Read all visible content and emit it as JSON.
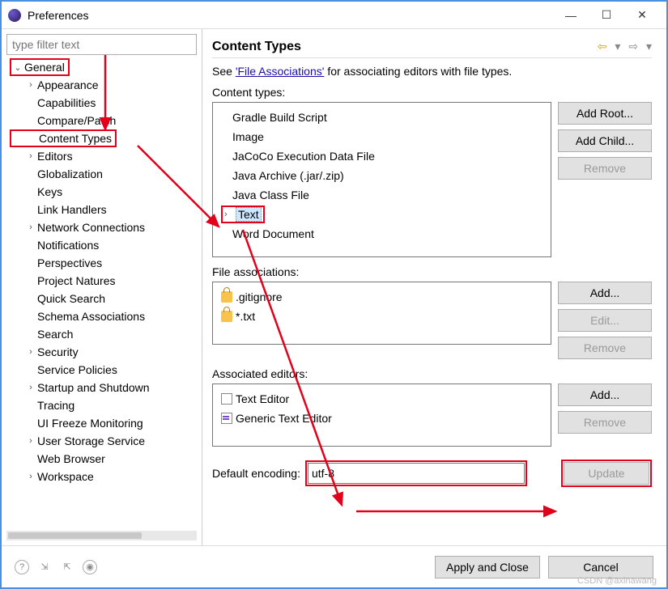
{
  "window": {
    "title": "Preferences"
  },
  "filter": {
    "placeholder": "type filter text"
  },
  "tree": {
    "root": "General",
    "items": [
      {
        "label": "Appearance",
        "chev": true
      },
      {
        "label": "Capabilities",
        "chev": false
      },
      {
        "label": "Compare/Patch",
        "chev": false
      },
      {
        "label": "Content Types",
        "chev": false,
        "hl": true
      },
      {
        "label": "Editors",
        "chev": true
      },
      {
        "label": "Globalization",
        "chev": false
      },
      {
        "label": "Keys",
        "chev": false
      },
      {
        "label": "Link Handlers",
        "chev": false
      },
      {
        "label": "Network Connections",
        "chev": true
      },
      {
        "label": "Notifications",
        "chev": false
      },
      {
        "label": "Perspectives",
        "chev": false
      },
      {
        "label": "Project Natures",
        "chev": false
      },
      {
        "label": "Quick Search",
        "chev": false
      },
      {
        "label": "Schema Associations",
        "chev": false
      },
      {
        "label": "Search",
        "chev": false
      },
      {
        "label": "Security",
        "chev": true
      },
      {
        "label": "Service Policies",
        "chev": false
      },
      {
        "label": "Startup and Shutdown",
        "chev": true
      },
      {
        "label": "Tracing",
        "chev": false
      },
      {
        "label": "UI Freeze Monitoring",
        "chev": false
      },
      {
        "label": "User Storage Service",
        "chev": true
      },
      {
        "label": "Web Browser",
        "chev": false
      },
      {
        "label": "Workspace",
        "chev": true
      }
    ]
  },
  "header": {
    "title": "Content Types"
  },
  "see": {
    "pre": "See  ",
    "link": "'File Associations'",
    "post": " for associating editors with file types."
  },
  "content_types": {
    "label": "Content types:",
    "items": [
      {
        "label": "Gradle Build Script"
      },
      {
        "label": "Image"
      },
      {
        "label": "JaCoCo Execution Data File"
      },
      {
        "label": "Java Archive (.jar/.zip)"
      },
      {
        "label": "Java Class File"
      },
      {
        "label": "Text",
        "chev": true,
        "selected": true,
        "hl": true
      },
      {
        "label": "Word Document"
      }
    ],
    "btns": {
      "addRoot": "Add Root...",
      "addChild": "Add Child...",
      "remove": "Remove"
    }
  },
  "file_assoc": {
    "label": "File associations:",
    "items": [
      ".gitignore",
      "*.txt"
    ],
    "btns": {
      "add": "Add...",
      "edit": "Edit...",
      "remove": "Remove"
    }
  },
  "assoc_editors": {
    "label": "Associated editors:",
    "items": [
      "Text Editor",
      "Generic Text Editor"
    ],
    "btns": {
      "add": "Add...",
      "remove": "Remove"
    }
  },
  "encoding": {
    "label": "Default encoding: ",
    "value": "utf-8",
    "update": "Update"
  },
  "footer": {
    "apply": "Apply and Close",
    "cancel": "Cancel"
  },
  "watermark": "CSDN @axinawang"
}
